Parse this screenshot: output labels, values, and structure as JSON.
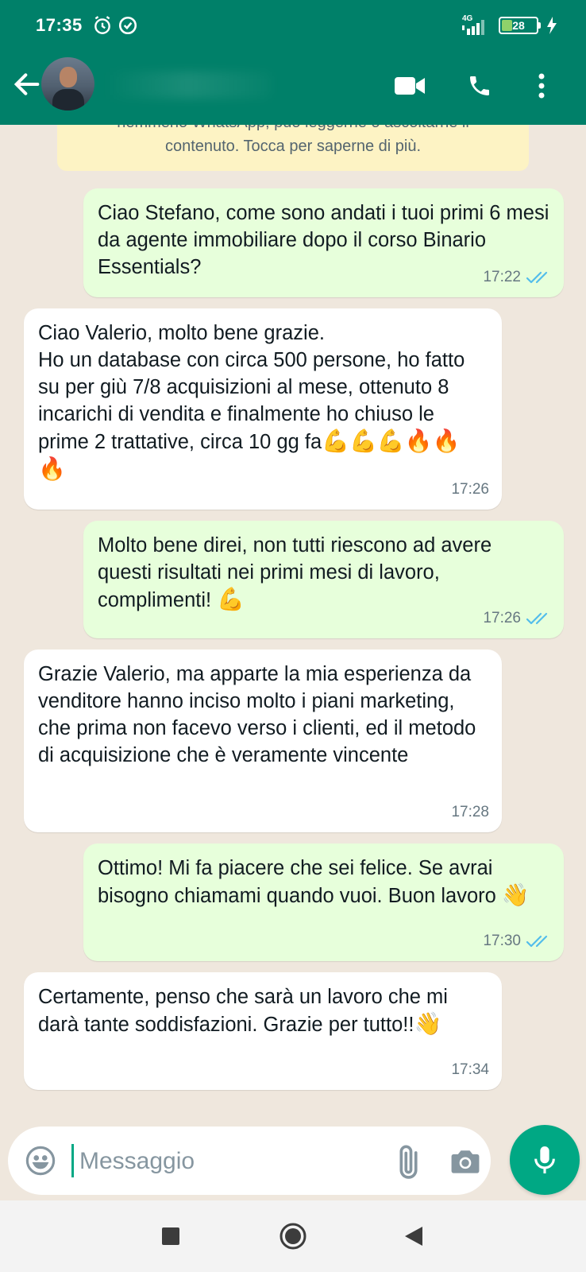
{
  "status_bar": {
    "time": "17:35",
    "network": "4G",
    "battery": "28"
  },
  "header": {
    "contact_name": "",
    "icons": [
      "arrow-back-icon",
      "video-call-icon",
      "phone-icon",
      "more-vert-icon"
    ]
  },
  "encryption_notice": {
    "line1": "nemmeno WhatsApp, può leggerne o ascoltarne il",
    "line2": "contenuto. Tocca per saperne di più."
  },
  "messages": [
    {
      "direction": "outgoing",
      "text": "Ciao Stefano, come sono andati i tuoi primi 6 mesi da agente immobiliare dopo il corso Binario Essentials?",
      "time": "17:22",
      "status": "read"
    },
    {
      "direction": "incoming",
      "text": "Ciao Valerio, molto bene grazie.\nHo un database con circa 500 persone, ho fatto su per giù 7/8 acquisizioni al mese, ottenuto 8 incarichi di vendita e finalmente ho chiuso le prime 2 trattative, circa 10 gg fa",
      "emoji": "💪💪💪🔥🔥🔥",
      "time": "17:26"
    },
    {
      "direction": "outgoing",
      "text": "Molto bene direi, non tutti riescono ad avere questi risultati nei primi mesi di lavoro, complimenti! ",
      "emoji": "💪",
      "time": "17:26",
      "status": "read"
    },
    {
      "direction": "incoming",
      "text": "Grazie Valerio, ma apparte la mia esperienza da venditore hanno inciso molto i piani marketing, che prima non facevo verso i clienti, ed il metodo di acquisizione che è veramente vincente",
      "time": "17:28"
    },
    {
      "direction": "outgoing",
      "text": "Ottimo! Mi fa piacere che sei felice. Se avrai bisogno chiamami quando vuoi. Buon lavoro ",
      "emoji": "👋",
      "time": "17:30",
      "status": "read"
    },
    {
      "direction": "incoming",
      "text": "Certamente, penso che sarà un lavoro che mi darà tante soddisfazioni. Grazie per tutto!!",
      "emoji": "👋",
      "time": "17:34"
    }
  ],
  "composer": {
    "placeholder": "Messaggio"
  },
  "colors": {
    "header": "#008069",
    "outgoing_bubble": "#e7ffdb",
    "incoming_bubble": "#ffffff",
    "background": "#efe7dd",
    "accent": "#00a884",
    "read_ticks": "#53bdeb"
  }
}
